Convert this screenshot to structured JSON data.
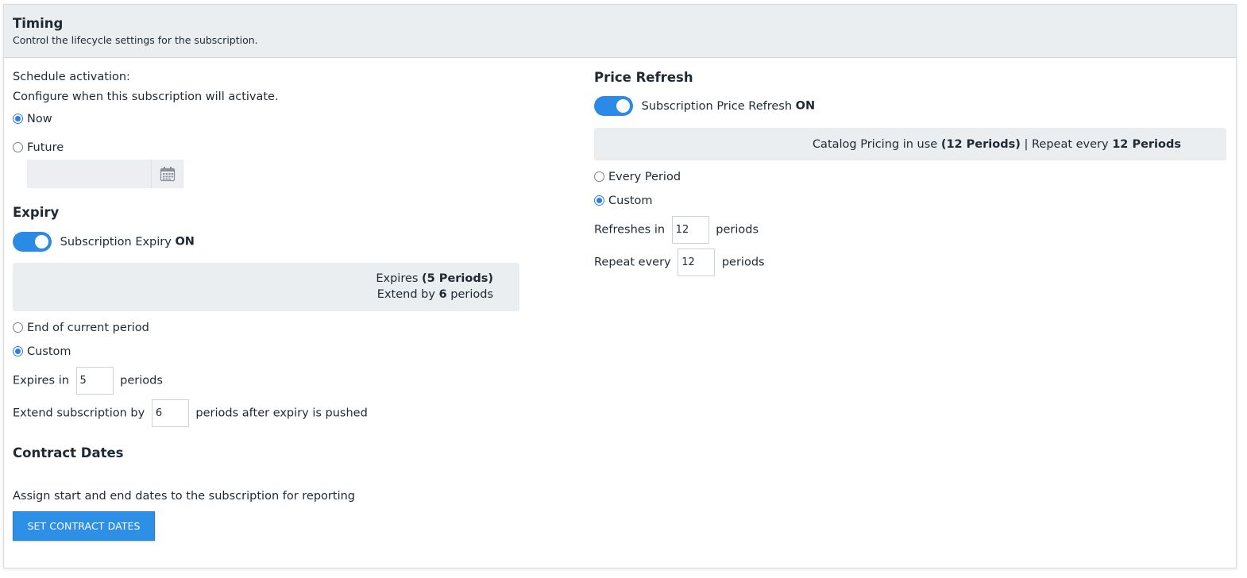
{
  "header": {
    "title": "Timing",
    "subtitle": "Control the lifecycle settings for the subscription."
  },
  "schedule": {
    "label": "Schedule activation:",
    "description": "Configure when this subscription will activate.",
    "options": [
      {
        "label": "Now",
        "checked": true
      },
      {
        "label": "Future",
        "checked": false
      }
    ],
    "date_value": ""
  },
  "expiry": {
    "title": "Expiry",
    "toggle_label": "Subscription Expiry",
    "toggle_state": "ON",
    "summary_line1_prefix": "Expires",
    "summary_line1_value": "(5 Periods)",
    "summary_line2_prefix": "Extend by",
    "summary_line2_value": "6",
    "summary_line2_suffix": "periods",
    "options": [
      {
        "label": "End of current period",
        "checked": false
      },
      {
        "label": "Custom",
        "checked": true
      }
    ],
    "expires_in_label": "Expires in",
    "expires_in_value": "5",
    "expires_in_suffix": "periods",
    "extend_label": "Extend subscription by",
    "extend_value": "6",
    "extend_suffix": "periods after expiry is pushed"
  },
  "contract": {
    "title": "Contract Dates",
    "description": "Assign start and end dates to the subscription for reporting",
    "button_label": "SET CONTRACT DATES"
  },
  "price_refresh": {
    "title": "Price Refresh",
    "toggle_label": "Subscription Price Refresh",
    "toggle_state": "ON",
    "summary_prefix": "Catalog Pricing in use",
    "summary_periods": "(12 Periods)",
    "summary_sep": "|",
    "summary_repeat_label": "Repeat every",
    "summary_repeat_value": "12 Periods",
    "options": [
      {
        "label": "Every Period",
        "checked": false
      },
      {
        "label": "Custom",
        "checked": true
      }
    ],
    "refreshes_label": "Refreshes in",
    "refreshes_value": "12",
    "refreshes_suffix": "periods",
    "repeat_label": "Repeat every",
    "repeat_value": "12",
    "repeat_suffix": "periods"
  },
  "colors": {
    "accent": "#2d8fe6",
    "header_bg": "#ebeef1",
    "info_bg": "#ebeef1"
  },
  "icons": {
    "calendar": "calendar-icon"
  }
}
